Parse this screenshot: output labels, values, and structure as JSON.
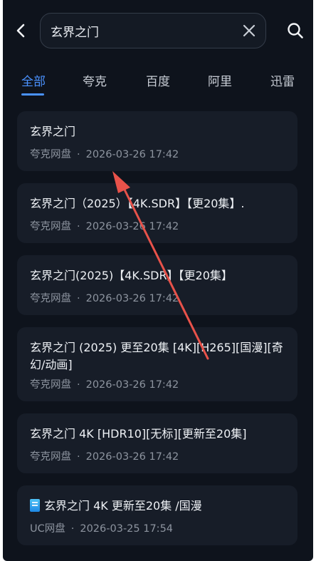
{
  "search": {
    "query": "玄界之门"
  },
  "tabs": [
    {
      "label": "全部",
      "active": true
    },
    {
      "label": "夸克",
      "active": false
    },
    {
      "label": "百度",
      "active": false
    },
    {
      "label": "阿里",
      "active": false
    },
    {
      "label": "迅雷",
      "active": false
    }
  ],
  "results": [
    {
      "title": "玄界之门",
      "source": "夸克网盘",
      "time": "2026-03-26 17:42"
    },
    {
      "title": "玄界之门（2025）【4K.SDR】【更20集】.",
      "source": "夸克网盘",
      "time": "2026-03-26 17:42"
    },
    {
      "title": "玄界之门(2025)【4K.SDR】【更20集】",
      "source": "夸克网盘",
      "time": "2026-03-26 17:42"
    },
    {
      "title": "玄界之门 (2025) 更至20集 [4K][H265][国漫][奇幻/动画]",
      "source": "夸克网盘",
      "time": "2026-03-26 17:42"
    },
    {
      "title": "玄界之门 4K [HDR10][无标][更新至20集]",
      "source": "夸克网盘",
      "time": "2026-03-26 17:42"
    },
    {
      "title": "玄界之门 4K 更新至20集 /国漫",
      "source": "UC网盘",
      "time": "2026-03-25 17:54"
    }
  ],
  "colors": {
    "background": "#0e131c",
    "card": "#171d28",
    "accent": "#4a92ff",
    "annotation_arrow": "#e8524a"
  },
  "icons": {
    "back": "chevron-left-icon",
    "clear": "close-icon",
    "search": "search-icon",
    "folder": "folder-emoji-icon"
  }
}
